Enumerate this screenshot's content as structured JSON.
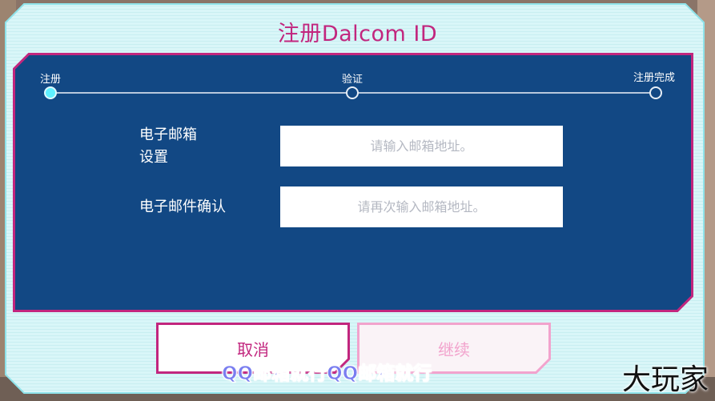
{
  "dialog": {
    "title": "注册Dalcom ID"
  },
  "steps": [
    {
      "label": "注册",
      "active": true
    },
    {
      "label": "验证",
      "active": false
    },
    {
      "label": "注册完成",
      "active": false
    }
  ],
  "form": {
    "email_label_line1": "电子邮箱",
    "email_label_line2": "设置",
    "email_placeholder": "请输入邮箱地址。",
    "confirm_label": "电子邮件确认",
    "confirm_placeholder": "请再次输入邮箱地址。"
  },
  "buttons": {
    "cancel": "取消",
    "continue": "继续"
  },
  "overlay": {
    "subtitle": "QQ邮箱就行QQ邮箱就行",
    "watermark": "大玩家"
  },
  "colors": {
    "accent": "#c2267e",
    "panel": "#124884",
    "frame": "#d9f6f8",
    "active_step": "#5ff0ff"
  }
}
